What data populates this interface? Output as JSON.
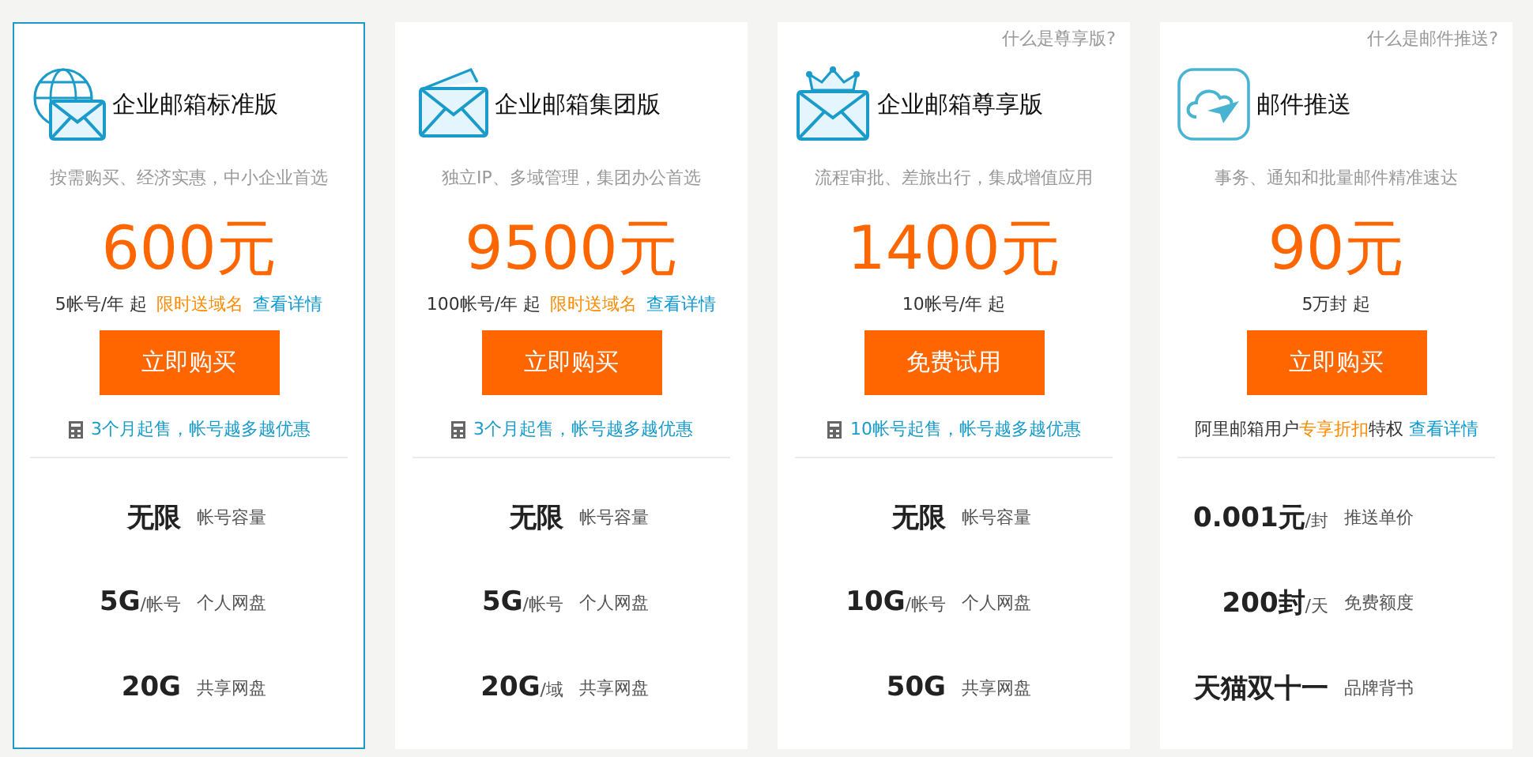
{
  "plans": [
    {
      "selected": true,
      "kind": "globe-mail",
      "title": "企业邮箱标准版",
      "subtitle": "按需购买、经济实惠，中小企业首选",
      "price": "600元",
      "terms": [
        {
          "kind": "plain",
          "text": "5帐号/年 起"
        },
        {
          "kind": "promo",
          "text": "限时送域名"
        },
        {
          "kind": "link",
          "text": "查看详情"
        }
      ],
      "button": "立即购买",
      "note": {
        "kind": "calculator",
        "segments": [
          {
            "kind": "accent",
            "text": "3个月起售，帐号越多越优惠"
          }
        ]
      },
      "features": [
        {
          "value": "无限",
          "label": "帐号容量"
        },
        {
          "value": "5G",
          "unit": "/帐号",
          "label": "个人网盘"
        },
        {
          "value": "20G",
          "label": "共享网盘"
        }
      ]
    },
    {
      "selected": false,
      "kind": "mail-stack",
      "title": "企业邮箱集团版",
      "subtitle": "独立IP、多域管理，集团办公首选",
      "price": "9500元",
      "terms": [
        {
          "kind": "plain",
          "text": "100帐号/年 起"
        },
        {
          "kind": "promo",
          "text": "限时送域名"
        },
        {
          "kind": "link",
          "text": "查看详情"
        }
      ],
      "button": "立即购买",
      "note": {
        "kind": "calculator",
        "segments": [
          {
            "kind": "accent",
            "text": "3个月起售，帐号越多越优惠"
          }
        ]
      },
      "features": [
        {
          "value": "无限",
          "label": "帐号容量"
        },
        {
          "value": "5G",
          "unit": "/帐号",
          "label": "个人网盘"
        },
        {
          "value": "20G",
          "unit": "/域",
          "label": "共享网盘"
        }
      ]
    },
    {
      "selected": false,
      "help_link": "什么是尊享版?",
      "kind": "crown-mail",
      "title": "企业邮箱尊享版",
      "subtitle": "流程审批、差旅出行，集成增值应用",
      "price": "1400元",
      "terms": [
        {
          "kind": "plain",
          "text": "10帐号/年 起"
        }
      ],
      "button": "免费试用",
      "note": {
        "kind": "calculator",
        "segments": [
          {
            "kind": "accent",
            "text": "10帐号起售，帐号越多越优惠"
          }
        ]
      },
      "features": [
        {
          "value": "无限",
          "label": "帐号容量"
        },
        {
          "value": "10G",
          "unit": "/帐号",
          "label": "个人网盘"
        },
        {
          "value": "50G",
          "label": "共享网盘"
        }
      ]
    },
    {
      "selected": false,
      "help_link": "什么是邮件推送?",
      "kind": "cloud-plane",
      "title": "邮件推送",
      "subtitle": "事务、通知和批量邮件精准速达",
      "price": "90元",
      "terms": [
        {
          "kind": "plain",
          "text": "5万封 起"
        }
      ],
      "button": "立即购买",
      "note": {
        "kind": "plain",
        "segments": [
          {
            "kind": "plain",
            "text": "阿里邮箱用户"
          },
          {
            "kind": "promo",
            "text": "专享折扣"
          },
          {
            "kind": "plain",
            "text": "特权"
          },
          {
            "kind": "link",
            "text": "查看详情"
          }
        ]
      },
      "features": [
        {
          "value": "0.001元",
          "unit": "/封",
          "label": "推送单价"
        },
        {
          "value": "200封",
          "unit": "/天",
          "label": "免费额度"
        },
        {
          "value": "天猫双十一",
          "label": "品牌背书"
        }
      ]
    }
  ]
}
